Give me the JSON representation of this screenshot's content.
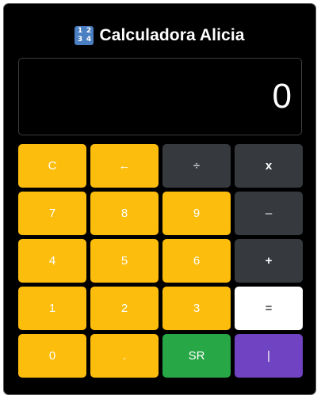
{
  "app": {
    "title": "Calculadora Alicia",
    "title_icon": {
      "name": "numbers-1234-icon",
      "glyphs": [
        "1",
        "2",
        "3",
        "4"
      ],
      "color": "#4a7fc1"
    }
  },
  "display": {
    "value": "0"
  },
  "colors": {
    "panel": "#000000",
    "number_key": "#fdbd0d",
    "operator_key": "#363a3e",
    "equals_key": "#ffffff",
    "sr_key": "#27a745",
    "bar_key": "#6f43c1"
  },
  "keys": [
    {
      "label": "C"
    },
    {
      "label": "←"
    },
    {
      "label": "÷"
    },
    {
      "label": "x"
    },
    {
      "label": "7"
    },
    {
      "label": "8"
    },
    {
      "label": "9"
    },
    {
      "label": "–"
    },
    {
      "label": "4"
    },
    {
      "label": "5"
    },
    {
      "label": "6"
    },
    {
      "label": "+"
    },
    {
      "label": "1"
    },
    {
      "label": "2"
    },
    {
      "label": "3"
    },
    {
      "label": "="
    },
    {
      "label": "0"
    },
    {
      "label": "."
    },
    {
      "label": "SR"
    },
    {
      "label": "|"
    }
  ]
}
